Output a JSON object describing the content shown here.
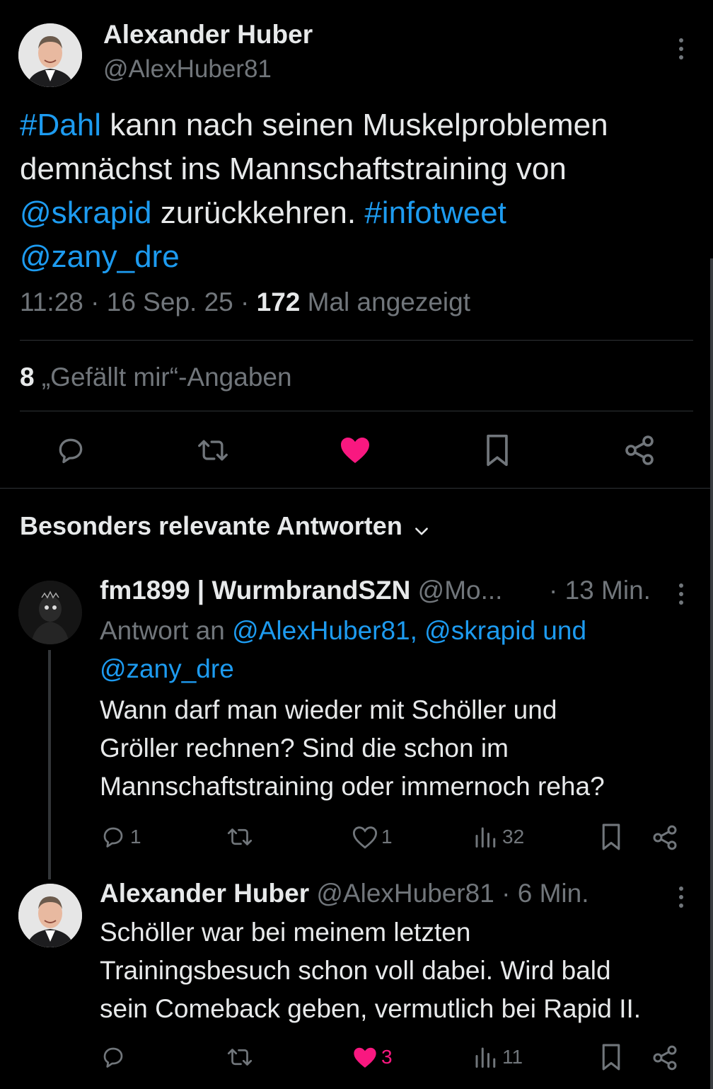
{
  "tweet": {
    "author_name": "Alexander Huber",
    "author_handle": "@AlexHuber81",
    "text": {
      "line1_tag": "#Dahl",
      "line1_rest": " kann nach seinen Muskelproblemen",
      "line2": "demnächst ins Mannschaftstraining von",
      "line3_mention": "@skrapid",
      "line3_rest": " zurückkehren. ",
      "line3_tag": "#infotweet",
      "line4_mention": "@zany_dre"
    },
    "time": "11:28",
    "date": "16 Sep. 25",
    "views_count": "172",
    "views_label": "Mal angezeigt",
    "likes_count": "8",
    "likes_label": "„Gefällt mir“-Angaben"
  },
  "replies_section": {
    "title": "Besonders relevante Antworten"
  },
  "replies": [
    {
      "author_name": "fm1899 | WurmbrandSZN",
      "author_handle": "@Mo...",
      "time": "· 13 Min.",
      "reply_to_label": "Antwort an",
      "reply_to_line1": "@AlexHuber81, @skrapid und",
      "reply_to_line2": "@zany_dre",
      "text_lines": [
        "Wann darf man wieder mit Schöller und",
        "Gröller rechnen? Sind die schon im",
        "Mannschaftstraining oder immernoch reha?"
      ],
      "replies_count": "1",
      "likes_count": "1",
      "views_count": "32"
    },
    {
      "author_name": "Alexander Huber",
      "author_handle": "@AlexHuber81",
      "time": "· 6 Min.",
      "text_lines": [
        "Schöller war bei meinem letzten",
        "Trainingsbesuch schon voll dabei. Wird bald",
        "sein Comeback geben, vermutlich bei Rapid II."
      ],
      "likes_count": "3",
      "views_count": "11"
    }
  ],
  "colors": {
    "background": "#000000",
    "text": "#e7e9ea",
    "secondary": "#71767b",
    "accent": "#1d9bf0",
    "like": "#f91880"
  },
  "icons": [
    "more-icon",
    "reply-icon",
    "retweet-icon",
    "like-icon",
    "bookmark-icon",
    "share-icon",
    "views-icon",
    "chevron-down-icon"
  ]
}
